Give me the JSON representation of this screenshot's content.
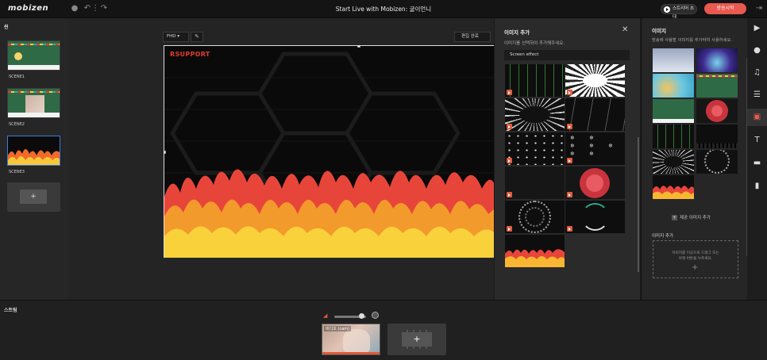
{
  "app": {
    "logo": "mobizen",
    "title": "Start Live with Mobizen: 굴이언니",
    "streamer_label": "스트리머 초대",
    "broadcast_label": "방송시작"
  },
  "scenes": {
    "title": "씬",
    "items": [
      {
        "label": "SCENE1"
      },
      {
        "label": "SCENE2"
      },
      {
        "label": "SCENE3"
      }
    ],
    "add_label": "+"
  },
  "canvas": {
    "resolution": "FHD ▾",
    "edit_label": "편집 완료",
    "stage_logo": "RSUPPORT"
  },
  "image_popup": {
    "title": "이미지 추가",
    "close": "✕",
    "subtitle": "이미지를 선택하여 추가해주세요.",
    "category": "Screen effect",
    "effects": [
      "matrix-code",
      "radial-burst-white",
      "radial-burst-dark",
      "rain-streaks",
      "dots-scatter",
      "snowflakes",
      "blank-dark",
      "red-circle",
      "dotted-rings",
      "arc-rings",
      "fire"
    ]
  },
  "image_panel": {
    "title": "이미지",
    "subtitle": "방송에 사용할 이미지를 추가하여 사용하세요.",
    "provided_label": "제공 이미지 추가",
    "add_title": "이미지 추가",
    "drop_line1": "이미지를 이곳으로 드래그 또는",
    "drop_line2": "아래 버튼을 누르세요.",
    "drop_plus": "+"
  },
  "side_icons": [
    "play-icon",
    "sticker-icon",
    "music-icon",
    "layout-icon",
    "image-icon",
    "text-icon",
    "banner-icon",
    "bookmark-icon"
  ],
  "stream": {
    "title": "스트림",
    "cam_label": "비디오 (cam)",
    "add_label": "+"
  },
  "colors": {
    "accent": "#e8594f",
    "selected": "#3b7be0"
  }
}
